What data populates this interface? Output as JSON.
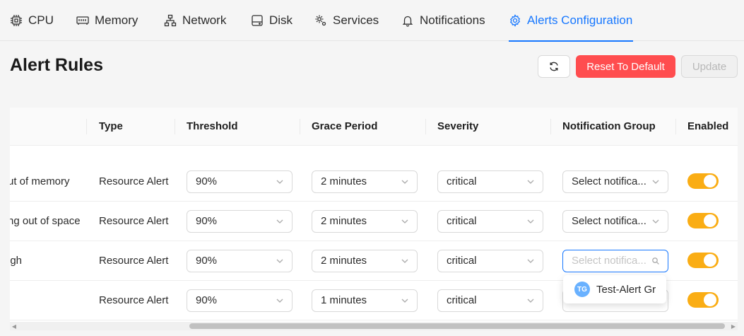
{
  "tabs": [
    {
      "label": "CPU",
      "icon": "cpu-icon"
    },
    {
      "label": "Memory",
      "icon": "memory-icon"
    },
    {
      "label": "Network",
      "icon": "network-icon"
    },
    {
      "label": "Disk",
      "icon": "disk-icon"
    },
    {
      "label": "Services",
      "icon": "services-icon"
    },
    {
      "label": "Notifications",
      "icon": "bell-icon"
    },
    {
      "label": "Alerts Configuration",
      "icon": "gear-icon",
      "active": true
    }
  ],
  "header": {
    "title": "Alert Rules",
    "reset_label": "Reset To Default",
    "update_label": "Update"
  },
  "table": {
    "columns": [
      "Type",
      "Threshold",
      "Grace Period",
      "Severity",
      "Notification Group",
      "Enabled"
    ],
    "rows": [
      {
        "name": "ut of memory",
        "type": "Resource Alert",
        "threshold": "90%",
        "grace": "2 minutes",
        "severity": "critical",
        "group": "Select notifica...",
        "enabled": true
      },
      {
        "name": "ng out of space",
        "type": "Resource Alert",
        "threshold": "90%",
        "grace": "2 minutes",
        "severity": "critical",
        "group": "Select notifica...",
        "enabled": true
      },
      {
        "name": "igh",
        "type": "Resource Alert",
        "threshold": "90%",
        "grace": "2 minutes",
        "severity": "critical",
        "group": "Select notifica...",
        "enabled": true
      },
      {
        "name": "",
        "type": "Resource Alert",
        "threshold": "90%",
        "grace": "1 minutes",
        "severity": "critical",
        "group": "",
        "enabled": true
      }
    ]
  },
  "dropdown": {
    "option_label": "Test-Alert Gr",
    "option_initials": "TG"
  },
  "colors": {
    "accent": "#1677ff",
    "danger": "#ff4d4f",
    "toggle_on": "#faad14"
  }
}
